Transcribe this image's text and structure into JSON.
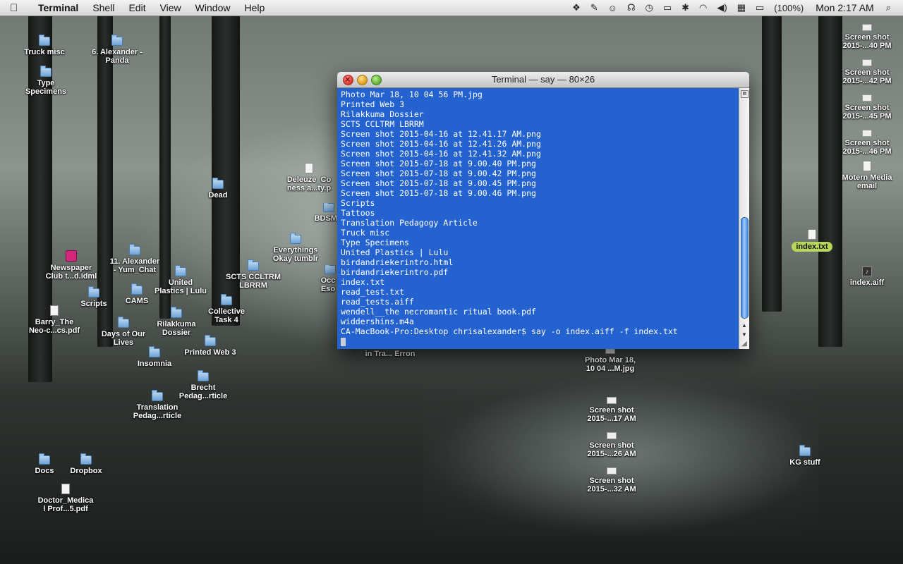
{
  "menubar": {
    "apple": "",
    "app_name": "Terminal",
    "menus": [
      "Shell",
      "Edit",
      "View",
      "Window",
      "Help"
    ],
    "battery": "(100%)",
    "clock": "Mon 2:17 AM"
  },
  "terminal": {
    "title": "Terminal — say — 80×26",
    "lines": [
      "Photo Mar 18, 10 04 56 PM.jpg",
      "Printed Web 3",
      "Rilakkuma Dossier",
      "SCTS CCLTRM LBRRM",
      "Screen shot 2015-04-16 at 12.41.17 AM.png",
      "Screen shot 2015-04-16 at 12.41.26 AM.png",
      "Screen shot 2015-04-16 at 12.41.32 AM.png",
      "Screen shot 2015-07-18 at 9.00.40 PM.png",
      "Screen shot 2015-07-18 at 9.00.42 PM.png",
      "Screen shot 2015-07-18 at 9.00.45 PM.png",
      "Screen shot 2015-07-18 at 9.00.46 PM.png",
      "Scripts",
      "Tattoos",
      "Translation Pedagogy Article",
      "Truck misc",
      "Type Specimens",
      "United Plastics | Lulu",
      "birdandriekerintro.html",
      "birdandriekerintro.pdf",
      "index.txt",
      "read_test.txt",
      "read_tests.aiff",
      "wendell__the necromantic ritual book.pdf",
      "widdershins.m4a",
      "CA-MacBook-Pro:Desktop chrisalexander$ say -o index.aiff -f index.txt"
    ]
  },
  "desktop_icons": [
    {
      "label": "Truck misc",
      "kind": "folder"
    },
    {
      "label": "6. Alexander -\nPanda",
      "kind": "folder"
    },
    {
      "label": "Type\nSpecimens",
      "kind": "folder"
    },
    {
      "label": "Newspaper\nClub t...d.idml",
      "kind": "idml"
    },
    {
      "label": "11. Alexander\n- Yum_Chat",
      "kind": "folder"
    },
    {
      "label": "Scripts",
      "kind": "folder"
    },
    {
      "label": "CAMS",
      "kind": "folder"
    },
    {
      "label": "United\nPlastics | Lulu",
      "kind": "folder"
    },
    {
      "label": "Barry_The\nNeo-c...cs.pdf",
      "kind": "doc"
    },
    {
      "label": "Rilakkuma\nDossier",
      "kind": "folder"
    },
    {
      "label": "Days of Our\nLives",
      "kind": "folder"
    },
    {
      "label": "Insomnia",
      "kind": "folder"
    },
    {
      "label": "Printed Web 3",
      "kind": "folder"
    },
    {
      "label": "Collective\nTask 4",
      "kind": "folder"
    },
    {
      "label": "SCTS CCLTRM\nLBRRM",
      "kind": "folder"
    },
    {
      "label": "Dead",
      "kind": "folder"
    },
    {
      "label": "Deleuze_Co\nness a...ty.p",
      "kind": "doc"
    },
    {
      "label": "BDSM",
      "kind": "folder"
    },
    {
      "label": "Everythings\nOkay tumblr",
      "kind": "folder"
    },
    {
      "label": "Occ\nEso",
      "kind": "folder"
    },
    {
      "label": "Brecht\nPedag...rticle",
      "kind": "folder"
    },
    {
      "label": "Translation\nPedag...rticle",
      "kind": "folder"
    },
    {
      "label": "Docs",
      "kind": "folder"
    },
    {
      "label": "Dropbox",
      "kind": "folder"
    },
    {
      "label": "Doctor_Medica\nl Prof...5.pdf",
      "kind": "doc"
    },
    {
      "label": "in Tra... Erron",
      "kind": "folder"
    },
    {
      "label": "Photo Mar 18,\n10 04 ...M.jpg",
      "kind": "shot"
    },
    {
      "label": "Screen shot\n2015-...17 AM",
      "kind": "shot"
    },
    {
      "label": "Screen shot\n2015-...26 AM",
      "kind": "shot"
    },
    {
      "label": "Screen shot\n2015-...32 AM",
      "kind": "shot"
    },
    {
      "label": "Screen shot\n2015-...40 PM",
      "kind": "shot"
    },
    {
      "label": "Screen shot\n2015-...42 PM",
      "kind": "shot"
    },
    {
      "label": "Screen shot\n2015-...45 PM",
      "kind": "shot"
    },
    {
      "label": "Screen shot\n2015-...46 PM",
      "kind": "shot"
    },
    {
      "label": "Motern Media\nemail",
      "kind": "doc"
    },
    {
      "label": "index.txt",
      "kind": "doc"
    },
    {
      "label": "index.aiff",
      "kind": "audio"
    },
    {
      "label": "KG stuff",
      "kind": "folder"
    }
  ]
}
